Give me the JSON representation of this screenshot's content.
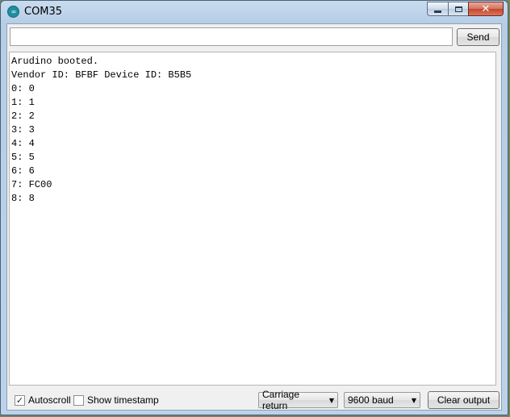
{
  "window": {
    "title": "COM35",
    "icon": "arduino-infinity-icon",
    "minimize_icon": "minimize-icon",
    "maximize_icon": "maximize-icon",
    "close_icon": "close-icon",
    "close_glyph": "✕"
  },
  "toolbar": {
    "input_value": "",
    "input_placeholder": "",
    "send_label": "Send"
  },
  "output": {
    "lines": [
      "Arudino booted.",
      "Vendor ID: BFBF Device ID: B5B5",
      "0: 0",
      "1: 1",
      "2: 2",
      "3: 3",
      "4: 4",
      "5: 5",
      "6: 6",
      "7: FC00",
      "8: 8"
    ]
  },
  "bottom": {
    "autoscroll_label": "Autoscroll",
    "autoscroll_checked": true,
    "check_glyph": "✓",
    "timestamp_label": "Show timestamp",
    "timestamp_checked": false,
    "line_ending_value": "Carriage return",
    "baud_value": "9600 baud",
    "dropdown_arrow": "▼",
    "clear_label": "Clear output"
  }
}
